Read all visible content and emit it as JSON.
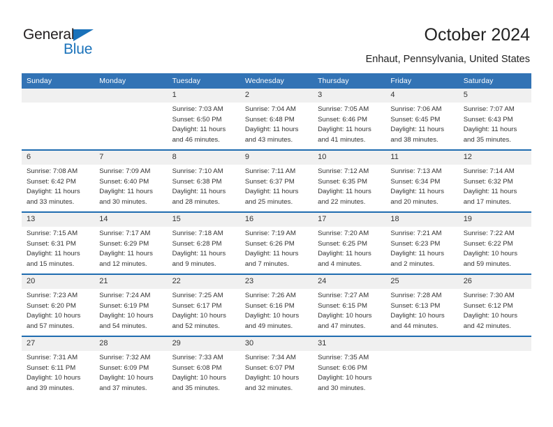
{
  "logo": {
    "word_top": "General",
    "word_bottom": "Blue",
    "triangle_color": "#1a72ba",
    "text_color": "#231f20"
  },
  "header": {
    "title": "October 2024",
    "subtitle": "Enhaut, Pennsylvania, United States"
  },
  "theme": {
    "header_blue": "#3273b5",
    "separator_blue": "#1f6cb0",
    "day_band_gray": "#f0f0f0",
    "text": "#333333"
  },
  "weekday_headers": [
    "Sunday",
    "Monday",
    "Tuesday",
    "Wednesday",
    "Thursday",
    "Friday",
    "Saturday"
  ],
  "weeks": [
    [
      {
        "day": "",
        "sunrise": "",
        "sunset": "",
        "daylight_line1": "",
        "daylight_line2": ""
      },
      {
        "day": "",
        "sunrise": "",
        "sunset": "",
        "daylight_line1": "",
        "daylight_line2": ""
      },
      {
        "day": "1",
        "sunrise": "Sunrise: 7:03 AM",
        "sunset": "Sunset: 6:50 PM",
        "daylight_line1": "Daylight: 11 hours",
        "daylight_line2": "and 46 minutes."
      },
      {
        "day": "2",
        "sunrise": "Sunrise: 7:04 AM",
        "sunset": "Sunset: 6:48 PM",
        "daylight_line1": "Daylight: 11 hours",
        "daylight_line2": "and 43 minutes."
      },
      {
        "day": "3",
        "sunrise": "Sunrise: 7:05 AM",
        "sunset": "Sunset: 6:46 PM",
        "daylight_line1": "Daylight: 11 hours",
        "daylight_line2": "and 41 minutes."
      },
      {
        "day": "4",
        "sunrise": "Sunrise: 7:06 AM",
        "sunset": "Sunset: 6:45 PM",
        "daylight_line1": "Daylight: 11 hours",
        "daylight_line2": "and 38 minutes."
      },
      {
        "day": "5",
        "sunrise": "Sunrise: 7:07 AM",
        "sunset": "Sunset: 6:43 PM",
        "daylight_line1": "Daylight: 11 hours",
        "daylight_line2": "and 35 minutes."
      }
    ],
    [
      {
        "day": "6",
        "sunrise": "Sunrise: 7:08 AM",
        "sunset": "Sunset: 6:42 PM",
        "daylight_line1": "Daylight: 11 hours",
        "daylight_line2": "and 33 minutes."
      },
      {
        "day": "7",
        "sunrise": "Sunrise: 7:09 AM",
        "sunset": "Sunset: 6:40 PM",
        "daylight_line1": "Daylight: 11 hours",
        "daylight_line2": "and 30 minutes."
      },
      {
        "day": "8",
        "sunrise": "Sunrise: 7:10 AM",
        "sunset": "Sunset: 6:38 PM",
        "daylight_line1": "Daylight: 11 hours",
        "daylight_line2": "and 28 minutes."
      },
      {
        "day": "9",
        "sunrise": "Sunrise: 7:11 AM",
        "sunset": "Sunset: 6:37 PM",
        "daylight_line1": "Daylight: 11 hours",
        "daylight_line2": "and 25 minutes."
      },
      {
        "day": "10",
        "sunrise": "Sunrise: 7:12 AM",
        "sunset": "Sunset: 6:35 PM",
        "daylight_line1": "Daylight: 11 hours",
        "daylight_line2": "and 22 minutes."
      },
      {
        "day": "11",
        "sunrise": "Sunrise: 7:13 AM",
        "sunset": "Sunset: 6:34 PM",
        "daylight_line1": "Daylight: 11 hours",
        "daylight_line2": "and 20 minutes."
      },
      {
        "day": "12",
        "sunrise": "Sunrise: 7:14 AM",
        "sunset": "Sunset: 6:32 PM",
        "daylight_line1": "Daylight: 11 hours",
        "daylight_line2": "and 17 minutes."
      }
    ],
    [
      {
        "day": "13",
        "sunrise": "Sunrise: 7:15 AM",
        "sunset": "Sunset: 6:31 PM",
        "daylight_line1": "Daylight: 11 hours",
        "daylight_line2": "and 15 minutes."
      },
      {
        "day": "14",
        "sunrise": "Sunrise: 7:17 AM",
        "sunset": "Sunset: 6:29 PM",
        "daylight_line1": "Daylight: 11 hours",
        "daylight_line2": "and 12 minutes."
      },
      {
        "day": "15",
        "sunrise": "Sunrise: 7:18 AM",
        "sunset": "Sunset: 6:28 PM",
        "daylight_line1": "Daylight: 11 hours",
        "daylight_line2": "and 9 minutes."
      },
      {
        "day": "16",
        "sunrise": "Sunrise: 7:19 AM",
        "sunset": "Sunset: 6:26 PM",
        "daylight_line1": "Daylight: 11 hours",
        "daylight_line2": "and 7 minutes."
      },
      {
        "day": "17",
        "sunrise": "Sunrise: 7:20 AM",
        "sunset": "Sunset: 6:25 PM",
        "daylight_line1": "Daylight: 11 hours",
        "daylight_line2": "and 4 minutes."
      },
      {
        "day": "18",
        "sunrise": "Sunrise: 7:21 AM",
        "sunset": "Sunset: 6:23 PM",
        "daylight_line1": "Daylight: 11 hours",
        "daylight_line2": "and 2 minutes."
      },
      {
        "day": "19",
        "sunrise": "Sunrise: 7:22 AM",
        "sunset": "Sunset: 6:22 PM",
        "daylight_line1": "Daylight: 10 hours",
        "daylight_line2": "and 59 minutes."
      }
    ],
    [
      {
        "day": "20",
        "sunrise": "Sunrise: 7:23 AM",
        "sunset": "Sunset: 6:20 PM",
        "daylight_line1": "Daylight: 10 hours",
        "daylight_line2": "and 57 minutes."
      },
      {
        "day": "21",
        "sunrise": "Sunrise: 7:24 AM",
        "sunset": "Sunset: 6:19 PM",
        "daylight_line1": "Daylight: 10 hours",
        "daylight_line2": "and 54 minutes."
      },
      {
        "day": "22",
        "sunrise": "Sunrise: 7:25 AM",
        "sunset": "Sunset: 6:17 PM",
        "daylight_line1": "Daylight: 10 hours",
        "daylight_line2": "and 52 minutes."
      },
      {
        "day": "23",
        "sunrise": "Sunrise: 7:26 AM",
        "sunset": "Sunset: 6:16 PM",
        "daylight_line1": "Daylight: 10 hours",
        "daylight_line2": "and 49 minutes."
      },
      {
        "day": "24",
        "sunrise": "Sunrise: 7:27 AM",
        "sunset": "Sunset: 6:15 PM",
        "daylight_line1": "Daylight: 10 hours",
        "daylight_line2": "and 47 minutes."
      },
      {
        "day": "25",
        "sunrise": "Sunrise: 7:28 AM",
        "sunset": "Sunset: 6:13 PM",
        "daylight_line1": "Daylight: 10 hours",
        "daylight_line2": "and 44 minutes."
      },
      {
        "day": "26",
        "sunrise": "Sunrise: 7:30 AM",
        "sunset": "Sunset: 6:12 PM",
        "daylight_line1": "Daylight: 10 hours",
        "daylight_line2": "and 42 minutes."
      }
    ],
    [
      {
        "day": "27",
        "sunrise": "Sunrise: 7:31 AM",
        "sunset": "Sunset: 6:11 PM",
        "daylight_line1": "Daylight: 10 hours",
        "daylight_line2": "and 39 minutes."
      },
      {
        "day": "28",
        "sunrise": "Sunrise: 7:32 AM",
        "sunset": "Sunset: 6:09 PM",
        "daylight_line1": "Daylight: 10 hours",
        "daylight_line2": "and 37 minutes."
      },
      {
        "day": "29",
        "sunrise": "Sunrise: 7:33 AM",
        "sunset": "Sunset: 6:08 PM",
        "daylight_line1": "Daylight: 10 hours",
        "daylight_line2": "and 35 minutes."
      },
      {
        "day": "30",
        "sunrise": "Sunrise: 7:34 AM",
        "sunset": "Sunset: 6:07 PM",
        "daylight_line1": "Daylight: 10 hours",
        "daylight_line2": "and 32 minutes."
      },
      {
        "day": "31",
        "sunrise": "Sunrise: 7:35 AM",
        "sunset": "Sunset: 6:06 PM",
        "daylight_line1": "Daylight: 10 hours",
        "daylight_line2": "and 30 minutes."
      },
      {
        "day": "",
        "sunrise": "",
        "sunset": "",
        "daylight_line1": "",
        "daylight_line2": ""
      },
      {
        "day": "",
        "sunrise": "",
        "sunset": "",
        "daylight_line1": "",
        "daylight_line2": ""
      }
    ]
  ]
}
